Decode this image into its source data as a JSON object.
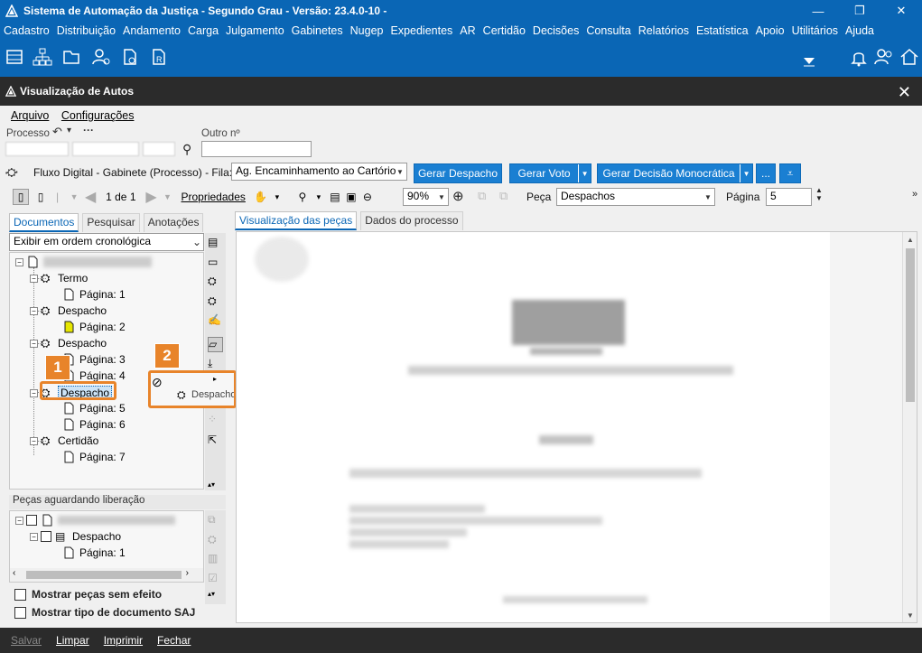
{
  "window": {
    "title": "Sistema de Automação da Justiça - Segundo Grau - Versão: 23.4.0-10 -",
    "controls": [
      "—",
      "❐",
      "✕"
    ]
  },
  "menu": [
    "Cadastro",
    "Distribuição",
    "Andamento",
    "Carga",
    "Julgamento",
    "Gabinetes",
    "Nugep",
    "Expedientes",
    "AR",
    "Certidão",
    "Decisões",
    "Consulta",
    "Relatórios",
    "Estatística",
    "Apoio",
    "Utilitários",
    "Ajuda"
  ],
  "toolbar_icons": [
    "document-list-icon",
    "hierarchy-icon",
    "folder-icon",
    "user-gear-icon",
    "document-clock-icon",
    "document-r-icon"
  ],
  "subwindow": {
    "title": "Visualização de Autos"
  },
  "submenu": [
    "Arquivo",
    "Configurações"
  ],
  "processo": {
    "label": "Processo",
    "outro_label": "Outro nº",
    "outro_value": ""
  },
  "fluxo": {
    "text": "Fluxo Digital - Gabinete (Processo) - Fila:",
    "fila_value": "Ag. Encaminhamento ao Cartório",
    "btn_despacho": "Gerar Despacho",
    "btn_voto": "Gerar Voto",
    "btn_decisao": "Gerar Decisão Monocrática",
    "btn_more": "..."
  },
  "viewer_toolbar": {
    "page_info": "1 de 1",
    "propriedades": "Propriedades",
    "zoom": "90%",
    "peca_label": "Peça",
    "peca_value": "Despachos",
    "pagina_label": "Página",
    "pagina_value": "5"
  },
  "left_tabs": [
    "Documentos",
    "Pesquisar",
    "Anotações"
  ],
  "right_tabs": [
    "Visualização das peças",
    "Dados do processo"
  ],
  "order_select": "Exibir em ordem cronológica",
  "tree": {
    "n0": "Termo",
    "n0p": "Página: 1",
    "n1": "Despacho",
    "n1p": "Página: 2",
    "n2": "Despacho",
    "n2p1": "Página: 3",
    "n2p2": "Página: 4",
    "n3": "Despacho",
    "n3p1": "Página: 5",
    "n3p2": "Página: 6",
    "n4": "Certidão",
    "n4p": "Página: 7"
  },
  "popup": {
    "label": "Despacho"
  },
  "pending": {
    "header": "Peças aguardando liberação",
    "doc": "Despacho",
    "page": "Página: 1"
  },
  "checkboxes": {
    "sem_efeito": "Mostrar peças sem efeito",
    "tipo_saj": "Mostrar tipo de documento SAJ"
  },
  "bottom": {
    "salvar": "Salvar",
    "limpar": "Limpar",
    "imprimir": "Imprimir",
    "fechar": "Fechar"
  },
  "callouts": {
    "one": "1",
    "two": "2"
  },
  "colors": {
    "brand": "#0a66b5",
    "accent_button": "#1a7fd2",
    "callout": "#e8842a",
    "dark_bar": "#2b2b2b"
  }
}
